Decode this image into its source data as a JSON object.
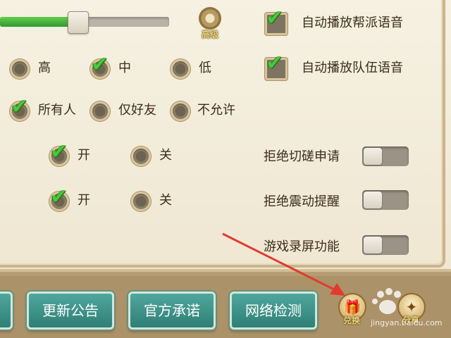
{
  "volume": {
    "level": 0.45
  },
  "advanced": {
    "label": "高级"
  },
  "voice_options": [
    {
      "label": "自动播放帮派语音",
      "checked": true
    },
    {
      "label": "自动播放队伍语音",
      "checked": true
    }
  ],
  "quality": {
    "options": [
      {
        "label": "高",
        "checked": false
      },
      {
        "label": "中",
        "checked": true
      },
      {
        "label": "低",
        "checked": false
      }
    ]
  },
  "visibility": {
    "options": [
      {
        "label": "所有人",
        "checked": true
      },
      {
        "label": "仅好友",
        "checked": false
      },
      {
        "label": "不允许",
        "checked": false
      }
    ]
  },
  "row4": {
    "on": "开",
    "off": "关",
    "value": "on"
  },
  "row5": {
    "on": "开",
    "off": "关",
    "value": "on"
  },
  "toggles": [
    {
      "label": "拒绝切磋申请",
      "on": false
    },
    {
      "label": "拒绝震动提醒",
      "on": false
    },
    {
      "label": "游戏录屏功能",
      "on": false
    }
  ],
  "bottom": {
    "buttons": [
      "更新公告",
      "官方承诺",
      "网络检测"
    ],
    "icon_buttons": [
      {
        "label": "兑换",
        "icon": "gift-icon"
      },
      {
        "label": "分享",
        "icon": "share-icon"
      }
    ]
  },
  "watermark": {
    "text": "jingyan.baidu.com",
    "icon": "baidu-paw-icon"
  },
  "colors": {
    "accent_green": "#3fb93a",
    "button_teal": "#3f958b",
    "panel_bg": "#f3eddc",
    "arrow_red": "#e23a2f"
  }
}
